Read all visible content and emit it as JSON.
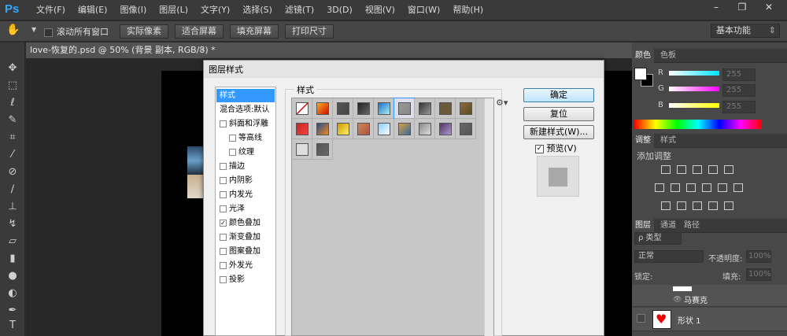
{
  "app": {
    "logo": "Ps"
  },
  "menu": [
    "文件(F)",
    "编辑(E)",
    "图像(I)",
    "图层(L)",
    "文字(Y)",
    "选择(S)",
    "滤镜(T)",
    "3D(D)",
    "视图(V)",
    "窗口(W)",
    "帮助(H)"
  ],
  "window_controls": {
    "minimize": "–",
    "restore": "❐",
    "close": "✕"
  },
  "options_bar": {
    "scroll_all": "滚动所有窗口",
    "buttons": [
      "实际像素",
      "适合屏幕",
      "填充屏幕",
      "打印尺寸"
    ],
    "workspace": "基本功能"
  },
  "document": {
    "tab_title": "love-恢复的.psd @ 50% (背景 副本, RGB/8) *",
    "close": "×"
  },
  "color_panel": {
    "tabs": [
      "颜色",
      "色板"
    ],
    "channels": [
      {
        "label": "R",
        "value": "255",
        "color": "#00e5ff"
      },
      {
        "label": "G",
        "value": "255",
        "color": "#ff00ff"
      },
      {
        "label": "B",
        "value": "255",
        "color": "#ffff00"
      }
    ]
  },
  "adjust_panel": {
    "tabs": [
      "调整",
      "样式"
    ],
    "title": "添加调整"
  },
  "layers_panel": {
    "tabs": [
      "图层",
      "通道",
      "路径"
    ],
    "filter_kind": "ρ 类型",
    "blend_mode": "正常",
    "opacity_label": "不透明度:",
    "opacity_value": "100%",
    "lock_label": "锁定:",
    "fill_label": "填充:",
    "fill_value": "100%",
    "layers": [
      "马赛克",
      "形状 1"
    ]
  },
  "dialog": {
    "title": "图层样式",
    "style_list": [
      {
        "label": "样式",
        "checkbox": false,
        "checked": false,
        "selected": true
      },
      {
        "label": "混合选项:默认",
        "checkbox": false,
        "checked": false,
        "selected": false
      },
      {
        "label": "斜面和浮雕",
        "checkbox": true,
        "checked": false
      },
      {
        "label": "等高线",
        "checkbox": true,
        "checked": false,
        "indent": true
      },
      {
        "label": "纹理",
        "checkbox": true,
        "checked": false,
        "indent": true
      },
      {
        "label": "描边",
        "checkbox": true,
        "checked": false
      },
      {
        "label": "内阴影",
        "checkbox": true,
        "checked": false
      },
      {
        "label": "内发光",
        "checkbox": true,
        "checked": false
      },
      {
        "label": "光泽",
        "checkbox": true,
        "checked": false
      },
      {
        "label": "颜色叠加",
        "checkbox": true,
        "checked": true
      },
      {
        "label": "渐变叠加",
        "checkbox": true,
        "checked": false
      },
      {
        "label": "图案叠加",
        "checkbox": true,
        "checked": false
      },
      {
        "label": "外发光",
        "checkbox": true,
        "checked": false
      },
      {
        "label": "投影",
        "checkbox": true,
        "checked": false
      }
    ],
    "styles_group_label": "样式",
    "buttons": {
      "ok": "确定",
      "reset": "复位",
      "new_style": "新建样式(W)..."
    },
    "preview_label": "预览(V)",
    "preview_checked": true
  }
}
